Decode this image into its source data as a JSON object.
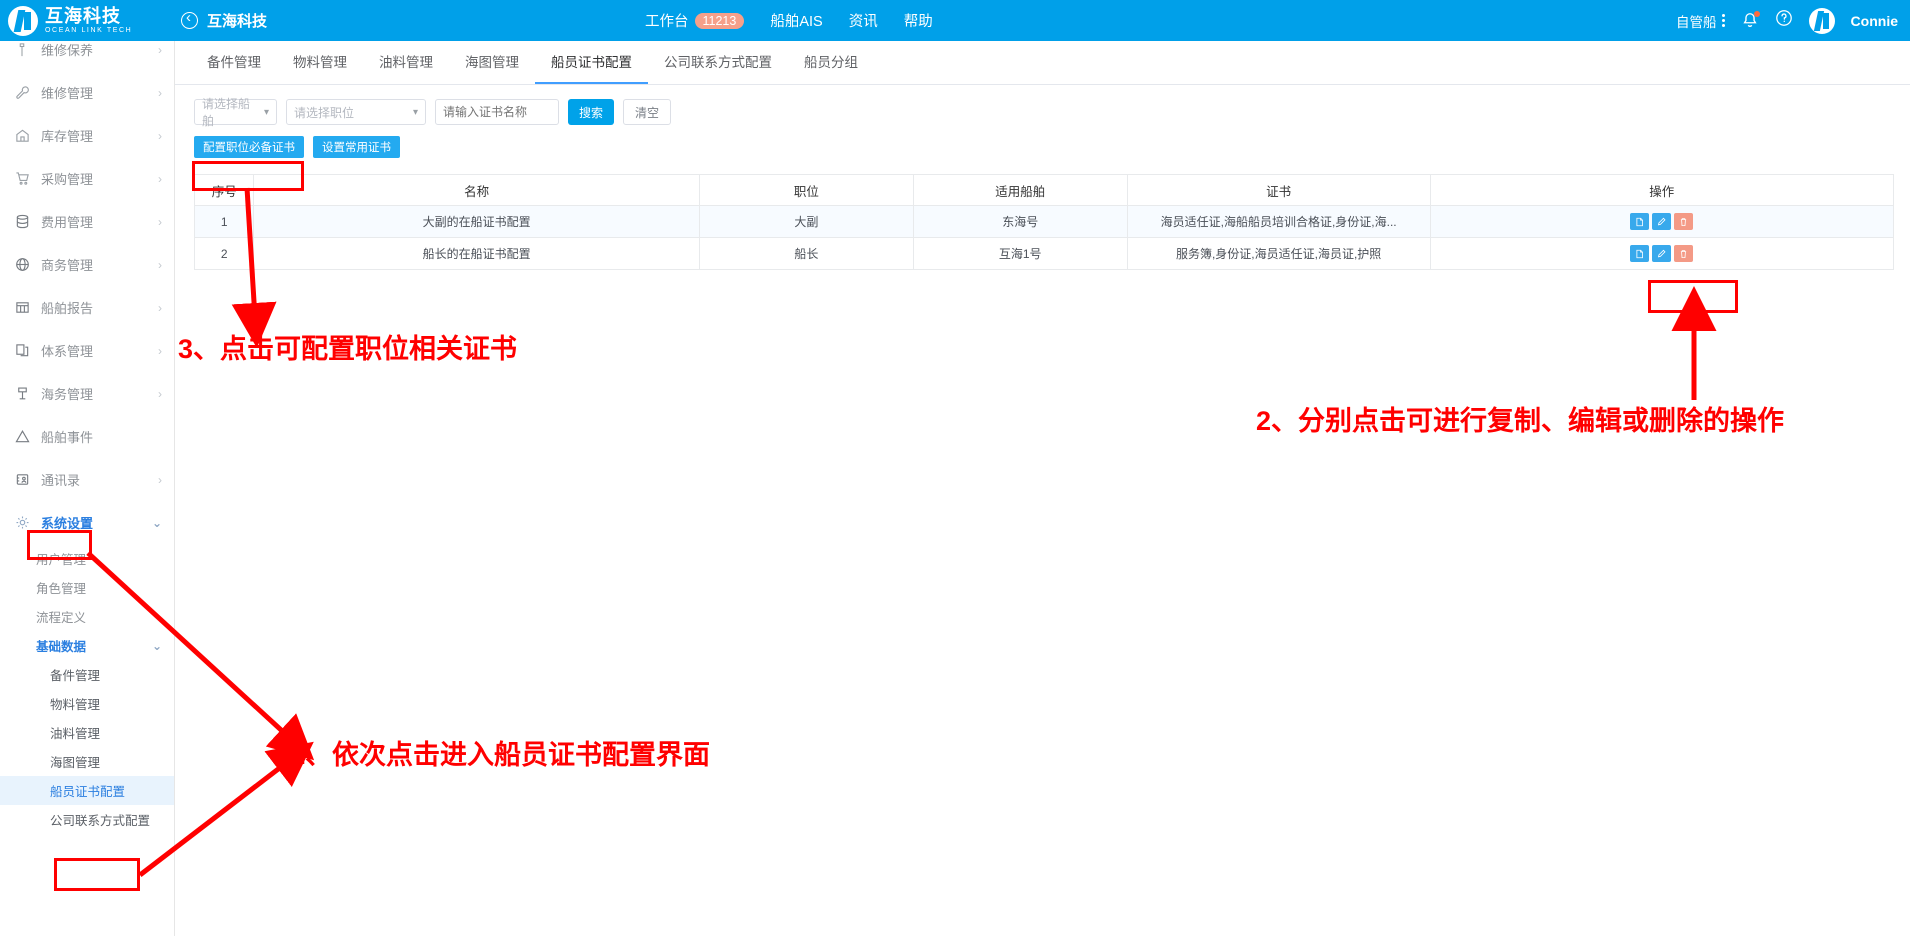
{
  "header": {
    "brand_cn": "互海科技",
    "brand_en": "OCEAN LINK TECH",
    "back_label": "互海科技",
    "nav": [
      {
        "label": "工作台",
        "badge": "11213"
      },
      {
        "label": "船舶AIS",
        "badge": ""
      },
      {
        "label": "资讯",
        "badge": ""
      },
      {
        "label": "帮助",
        "badge": ""
      }
    ],
    "ship_selector": "自管船",
    "username": "Connie",
    "bell_icon": "bell-icon",
    "help_icon": "question-circle-icon",
    "avatar_icon": "avatar"
  },
  "sidebar": {
    "items": [
      {
        "label": "维修保养",
        "icon": "wrench-tool-icon",
        "level": 1,
        "chevron": "›",
        "state": "normal"
      },
      {
        "label": "维修管理",
        "icon": "wrench-icon",
        "level": 1,
        "chevron": "›",
        "state": "normal"
      },
      {
        "label": "库存管理",
        "icon": "home-icon",
        "level": 1,
        "chevron": "›",
        "state": "normal"
      },
      {
        "label": "采购管理",
        "icon": "cart-icon",
        "level": 1,
        "chevron": "›",
        "state": "normal"
      },
      {
        "label": "费用管理",
        "icon": "database-icon",
        "level": 1,
        "chevron": "›",
        "state": "normal"
      },
      {
        "label": "商务管理",
        "icon": "globe-icon",
        "level": 1,
        "chevron": "›",
        "state": "normal"
      },
      {
        "label": "船舶报告",
        "icon": "grid-report-icon",
        "level": 1,
        "chevron": "›",
        "state": "normal"
      },
      {
        "label": "体系管理",
        "icon": "copy-doc-icon",
        "level": 1,
        "chevron": "›",
        "state": "normal"
      },
      {
        "label": "海务管理",
        "icon": "anchor-icon",
        "level": 1,
        "chevron": "›",
        "state": "normal"
      },
      {
        "label": "船舶事件",
        "icon": "warning-triangle-icon",
        "level": 1,
        "chevron": "",
        "state": "normal"
      },
      {
        "label": "通讯录",
        "icon": "contacts-icon",
        "level": 1,
        "chevron": "›",
        "state": "normal"
      },
      {
        "label": "系统设置",
        "icon": "gear-icon",
        "level": 1,
        "chevron": "⌄",
        "state": "active"
      },
      {
        "label": "用户管理",
        "icon": "",
        "level": 2,
        "chevron": "",
        "state": "normal"
      },
      {
        "label": "角色管理",
        "icon": "",
        "level": 2,
        "chevron": "",
        "state": "normal"
      },
      {
        "label": "流程定义",
        "icon": "",
        "level": 2,
        "chevron": "",
        "state": "normal"
      },
      {
        "label": "基础数据",
        "icon": "",
        "level": 2,
        "chevron": "⌄",
        "state": "active"
      },
      {
        "label": "备件管理",
        "icon": "",
        "level": 3,
        "chevron": "",
        "state": "normal"
      },
      {
        "label": "物料管理",
        "icon": "",
        "level": 3,
        "chevron": "",
        "state": "normal"
      },
      {
        "label": "油料管理",
        "icon": "",
        "level": 3,
        "chevron": "",
        "state": "normal"
      },
      {
        "label": "海图管理",
        "icon": "",
        "level": 3,
        "chevron": "",
        "state": "normal"
      },
      {
        "label": "船员证书配置",
        "icon": "",
        "level": 3,
        "chevron": "",
        "state": "selected"
      },
      {
        "label": "公司联系方式配置",
        "icon": "",
        "level": 3,
        "chevron": "",
        "state": "normal"
      }
    ]
  },
  "tabs": [
    {
      "label": "备件管理",
      "active": false
    },
    {
      "label": "物料管理",
      "active": false
    },
    {
      "label": "油料管理",
      "active": false
    },
    {
      "label": "海图管理",
      "active": false
    },
    {
      "label": "船员证书配置",
      "active": true
    },
    {
      "label": "公司联系方式配置",
      "active": false
    },
    {
      "label": "船员分组",
      "active": false
    }
  ],
  "filters": {
    "ship_select": "请选择船舶",
    "post_select": "请选择职位",
    "cert_input_placeholder": "请输入证书名称",
    "cert_input_value": "",
    "search_button": "搜索",
    "clear_button": "清空"
  },
  "actions": {
    "config_required_cert": "配置职位必备证书",
    "set_common_cert": "设置常用证书"
  },
  "table": {
    "columns": [
      "序号",
      "名称",
      "职位",
      "适用船舶",
      "证书",
      "操作"
    ],
    "rows": [
      {
        "no": "1",
        "name": "大副的在船证书配置",
        "post": "大副",
        "ship": "东海号",
        "cert": "海员适任证,海船船员培训合格证,身份证,海...",
        "ops": [
          "copy-icon",
          "edit-icon",
          "delete-icon"
        ]
      },
      {
        "no": "2",
        "name": "船长的在船证书配置",
        "post": "船长",
        "ship": "互海1号",
        "cert": "服务簿,身份证,海员适任证,海员证,护照",
        "ops": [
          "copy-icon",
          "edit-icon",
          "delete-icon"
        ]
      }
    ]
  },
  "annotations": [
    {
      "id": "a1",
      "text": "1、依次点击进入船员证书配置界面"
    },
    {
      "id": "a2",
      "text": "2、分别点击可进行复制、编辑或删除的操作"
    },
    {
      "id": "a3",
      "text": "3、点击可配置职位相关证书"
    }
  ],
  "colors": {
    "brand_blue": "#00a0e9",
    "accent_blue": "#409eff",
    "annotation_red": "#ff0000",
    "badge_orange": "#f6a08a",
    "delete_red": "#f49a86"
  }
}
